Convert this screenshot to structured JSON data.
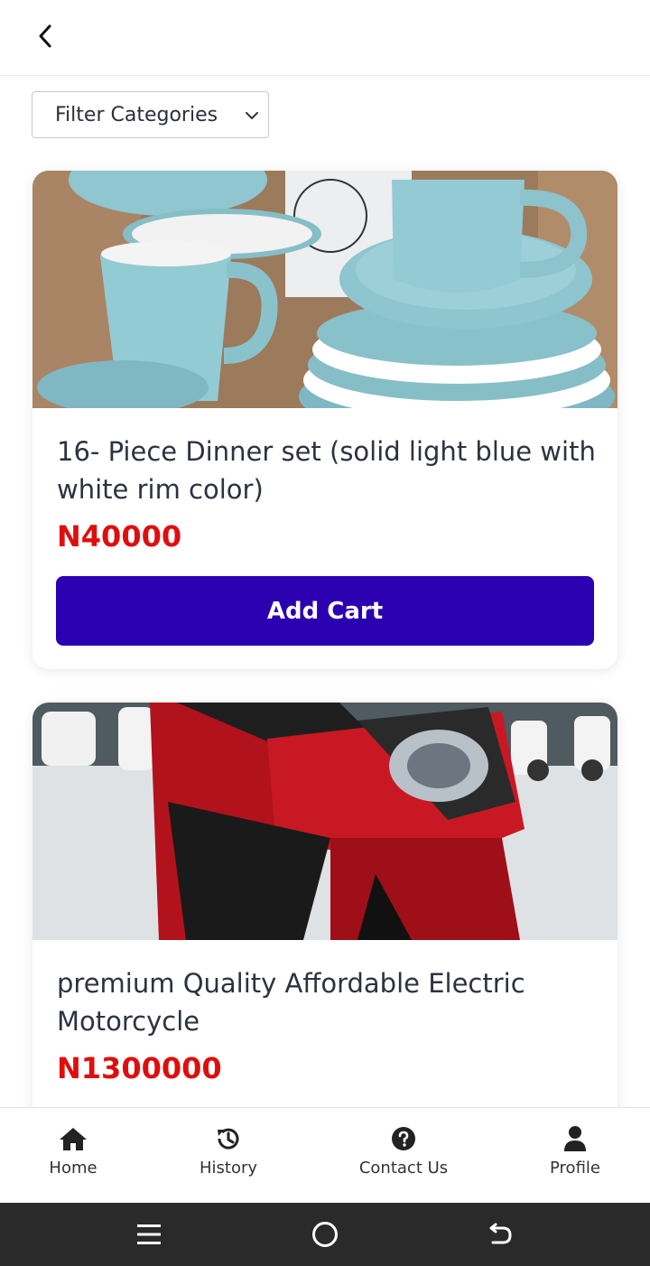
{
  "header": {
    "back_icon": "chevron-left-icon"
  },
  "filter": {
    "label": "Filter Categories",
    "icon": "chevron-down-icon"
  },
  "products": [
    {
      "title": "16- Piece Dinner set (solid light blue with white rim color)",
      "price": "N40000",
      "button": "Add Cart",
      "image": "light blue mugs, bowls and plates"
    },
    {
      "title": "premium Quality Affordable Electric Motorcycle",
      "price": "N1300000",
      "image": "red electric motorcycle front"
    }
  ],
  "nav": [
    {
      "label": "Home",
      "icon": "home-icon"
    },
    {
      "label": "History",
      "icon": "history-icon"
    },
    {
      "label": "Contact Us",
      "icon": "help-circle-icon"
    },
    {
      "label": "Profile",
      "icon": "person-icon"
    }
  ],
  "system_bar": {
    "icons": [
      "menu-icon",
      "home-circle-icon",
      "back-arrow-icon"
    ]
  },
  "colors": {
    "accent": "#2b00b0",
    "price": "#e00d0d",
    "text": "#2d3240"
  }
}
